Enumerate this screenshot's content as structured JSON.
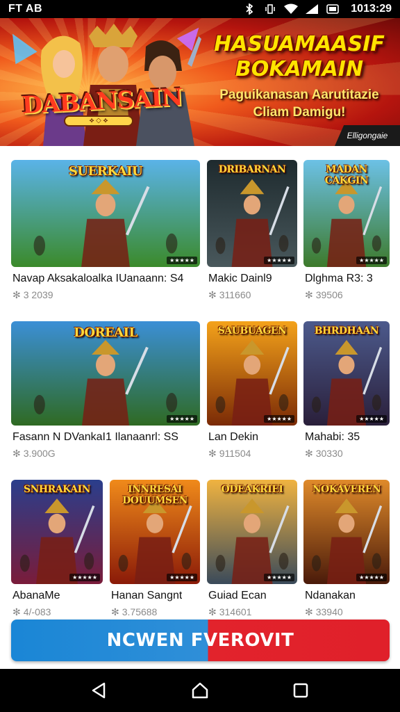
{
  "status_bar": {
    "left_text": "FT AB",
    "time": "1013:29",
    "icons": [
      "bluetooth-icon",
      "vibrate-icon",
      "wifi-icon",
      "signal-icon",
      "battery-icon"
    ]
  },
  "banner": {
    "logo_text": "DABANSAIN",
    "headline": "HASUAMAASIF BOKAMAIN",
    "subline": "Paguikanasan Aarutitazie Cliam Damigu!",
    "tag": "Elligongaie"
  },
  "games": [
    {
      "thumb_title": "SUERKAIU",
      "title": "Navap Aksakaloalka IUanaann: S4",
      "meta": "3 2039",
      "colors": [
        "#5ab3e8",
        "#3b8a2a"
      ]
    },
    {
      "thumb_title": "DRIBARNAN",
      "title": "Makic Dainl9",
      "meta": "311660",
      "colors": [
        "#1e2a2e",
        "#49585c"
      ]
    },
    {
      "thumb_title": "MADAN CAKGIN",
      "title": "Dlghma R3: 3",
      "meta": "39506",
      "colors": [
        "#6cc1e6",
        "#3d7a2b"
      ]
    },
    {
      "thumb_title": "DOREAIL",
      "title": "Fasann N DVankaI1 Ilanaanrl: SS",
      "meta": "3.900G",
      "colors": [
        "#3b8fd6",
        "#2f6a22"
      ]
    },
    {
      "thumb_title": "SAUBUAGEN",
      "title": "Lan Dekin",
      "meta": "911504",
      "colors": [
        "#f4a21a",
        "#7a2a06"
      ]
    },
    {
      "thumb_title": "BHRDHAAN",
      "title": "Mahabi: 35",
      "meta": "30330",
      "colors": [
        "#4c5a8c",
        "#2a1f3a"
      ]
    },
    {
      "thumb_title": "SNHRAKAIN",
      "title": "AbanaMe",
      "meta": "4/-083",
      "colors": [
        "#2a3e8c",
        "#7a1c3a"
      ]
    },
    {
      "thumb_title": "INNRESAI DOUUMSEN",
      "title": "Hanan Sangnt",
      "meta": "3.75688",
      "colors": [
        "#f08a1a",
        "#8a1a08"
      ]
    },
    {
      "thumb_title": "ODEAKRIEI",
      "title": "Guiad Ecan",
      "meta": "314601",
      "colors": [
        "#f0b340",
        "#3a4a5a"
      ]
    },
    {
      "thumb_title": "NOKAVEREN",
      "title": "Ndanakan",
      "meta": "33940",
      "colors": [
        "#e08a2a",
        "#4a1a0a"
      ]
    }
  ],
  "cta": {
    "label": "NCWEN FVEROVIT"
  },
  "nav": {
    "back": "back-icon",
    "home": "home-icon",
    "recents": "recents-icon"
  }
}
